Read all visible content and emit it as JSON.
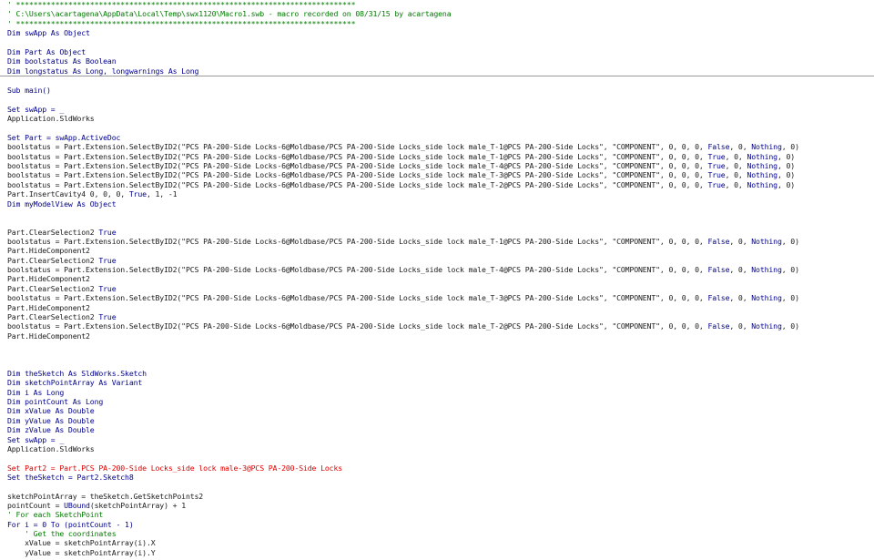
{
  "colors": {
    "background": "#ffffff",
    "keyword": "#00008b",
    "comment": "#007a00",
    "text": "#1a1a1a",
    "error": "#dd0000",
    "divider": "#9a9a9a"
  },
  "lines": [
    [
      {
        "t": "' ******************************************************************************",
        "c": "cm"
      }
    ],
    [
      {
        "t": "' C:\\Users\\acartagena\\AppData\\Local\\Temp\\swx1120\\Macro1.swb - macro recorded on 08/31/15 by acartagena",
        "c": "cm"
      }
    ],
    [
      {
        "t": "' ******************************************************************************",
        "c": "cm"
      }
    ],
    [
      {
        "t": "Dim swApp As Object",
        "c": "kw"
      }
    ],
    [],
    [
      {
        "t": "Dim Part As Object",
        "c": "kw"
      }
    ],
    [
      {
        "t": "Dim boolstatus As Boolean",
        "c": "kw"
      }
    ],
    [
      {
        "t": "Dim longstatus As Long, longwarnings As Long",
        "c": "kw"
      }
    ],
    [],
    [
      {
        "t": "Sub main()",
        "c": "kw"
      }
    ],
    [],
    [
      {
        "t": "Set swApp = _",
        "c": "kw"
      }
    ],
    [
      {
        "t": "Application.SldWorks",
        "c": "txt"
      }
    ],
    [],
    [
      {
        "t": "Set Part = swApp.ActiveDoc",
        "c": "kw"
      }
    ],
    [
      {
        "t": "boolstatus = Part.Extension.SelectByID2(\"PCS PA-200-Side Locks-6@Moldbase/PCS PA-200-Side Locks_side lock male_T-1@PCS PA-200-Side Locks\", \"COMPONENT\", 0, 0, 0, ",
        "c": "txt"
      },
      {
        "t": "False",
        "c": "kw"
      },
      {
        "t": ", 0, ",
        "c": "txt"
      },
      {
        "t": "Nothing",
        "c": "kw"
      },
      {
        "t": ", 0)",
        "c": "txt"
      }
    ],
    [
      {
        "t": "boolstatus = Part.Extension.SelectByID2(\"PCS PA-200-Side Locks-6@Moldbase/PCS PA-200-Side Locks_side lock male_T-1@PCS PA-200-Side Locks\", \"COMPONENT\", 0, 0, 0, ",
        "c": "txt"
      },
      {
        "t": "True",
        "c": "kw"
      },
      {
        "t": ", 0, ",
        "c": "txt"
      },
      {
        "t": "Nothing",
        "c": "kw"
      },
      {
        "t": ", 0)",
        "c": "txt"
      }
    ],
    [
      {
        "t": "boolstatus = Part.Extension.SelectByID2(\"PCS PA-200-Side Locks-6@Moldbase/PCS PA-200-Side Locks_side lock male_T-4@PCS PA-200-Side Locks\", \"COMPONENT\", 0, 0, 0, ",
        "c": "txt"
      },
      {
        "t": "True",
        "c": "kw"
      },
      {
        "t": ", 0, ",
        "c": "txt"
      },
      {
        "t": "Nothing",
        "c": "kw"
      },
      {
        "t": ", 0)",
        "c": "txt"
      }
    ],
    [
      {
        "t": "boolstatus = Part.Extension.SelectByID2(\"PCS PA-200-Side Locks-6@Moldbase/PCS PA-200-Side Locks_side lock male_T-3@PCS PA-200-Side Locks\", \"COMPONENT\", 0, 0, 0, ",
        "c": "txt"
      },
      {
        "t": "True",
        "c": "kw"
      },
      {
        "t": ", 0, ",
        "c": "txt"
      },
      {
        "t": "Nothing",
        "c": "kw"
      },
      {
        "t": ", 0)",
        "c": "txt"
      }
    ],
    [
      {
        "t": "boolstatus = Part.Extension.SelectByID2(\"PCS PA-200-Side Locks-6@Moldbase/PCS PA-200-Side Locks_side lock male_T-2@PCS PA-200-Side Locks\", \"COMPONENT\", 0, 0, 0, ",
        "c": "txt"
      },
      {
        "t": "True",
        "c": "kw"
      },
      {
        "t": ", 0, ",
        "c": "txt"
      },
      {
        "t": "Nothing",
        "c": "kw"
      },
      {
        "t": ", 0)",
        "c": "txt"
      }
    ],
    [
      {
        "t": "Part.InsertCavity4 0, 0, 0, ",
        "c": "txt"
      },
      {
        "t": "True",
        "c": "kw"
      },
      {
        "t": ", 1, -1",
        "c": "txt"
      }
    ],
    [
      {
        "t": "Dim myModelView As Object",
        "c": "kw"
      }
    ],
    [],
    [],
    [
      {
        "t": "Part.ClearSelection2 ",
        "c": "txt"
      },
      {
        "t": "True",
        "c": "kw"
      }
    ],
    [
      {
        "t": "boolstatus = Part.Extension.SelectByID2(\"PCS PA-200-Side Locks-6@Moldbase/PCS PA-200-Side Locks_side lock male_T-1@PCS PA-200-Side Locks\", \"COMPONENT\", 0, 0, 0, ",
        "c": "txt"
      },
      {
        "t": "False",
        "c": "kw"
      },
      {
        "t": ", 0, ",
        "c": "txt"
      },
      {
        "t": "Nothing",
        "c": "kw"
      },
      {
        "t": ", 0)",
        "c": "txt"
      }
    ],
    [
      {
        "t": "Part.HideComponent2",
        "c": "txt"
      }
    ],
    [
      {
        "t": "Part.ClearSelection2 ",
        "c": "txt"
      },
      {
        "t": "True",
        "c": "kw"
      }
    ],
    [
      {
        "t": "boolstatus = Part.Extension.SelectByID2(\"PCS PA-200-Side Locks-6@Moldbase/PCS PA-200-Side Locks_side lock male_T-4@PCS PA-200-Side Locks\", \"COMPONENT\", 0, 0, 0, ",
        "c": "txt"
      },
      {
        "t": "False",
        "c": "kw"
      },
      {
        "t": ", 0, ",
        "c": "txt"
      },
      {
        "t": "Nothing",
        "c": "kw"
      },
      {
        "t": ", 0)",
        "c": "txt"
      }
    ],
    [
      {
        "t": "Part.HideComponent2",
        "c": "txt"
      }
    ],
    [
      {
        "t": "Part.ClearSelection2 ",
        "c": "txt"
      },
      {
        "t": "True",
        "c": "kw"
      }
    ],
    [
      {
        "t": "boolstatus = Part.Extension.SelectByID2(\"PCS PA-200-Side Locks-6@Moldbase/PCS PA-200-Side Locks_side lock male_T-3@PCS PA-200-Side Locks\", \"COMPONENT\", 0, 0, 0, ",
        "c": "txt"
      },
      {
        "t": "False",
        "c": "kw"
      },
      {
        "t": ", 0, ",
        "c": "txt"
      },
      {
        "t": "Nothing",
        "c": "kw"
      },
      {
        "t": ", 0)",
        "c": "txt"
      }
    ],
    [
      {
        "t": "Part.HideComponent2",
        "c": "txt"
      }
    ],
    [
      {
        "t": "Part.ClearSelection2 ",
        "c": "txt"
      },
      {
        "t": "True",
        "c": "kw"
      }
    ],
    [
      {
        "t": "boolstatus = Part.Extension.SelectByID2(\"PCS PA-200-Side Locks-6@Moldbase/PCS PA-200-Side Locks_side lock male_T-2@PCS PA-200-Side Locks\", \"COMPONENT\", 0, 0, 0, ",
        "c": "txt"
      },
      {
        "t": "False",
        "c": "kw"
      },
      {
        "t": ", 0, ",
        "c": "txt"
      },
      {
        "t": "Nothing",
        "c": "kw"
      },
      {
        "t": ", 0)",
        "c": "txt"
      }
    ],
    [
      {
        "t": "Part.HideComponent2",
        "c": "txt"
      }
    ],
    [],
    [],
    [],
    [
      {
        "t": "Dim theSketch As SldWorks.Sketch",
        "c": "kw"
      }
    ],
    [
      {
        "t": "Dim sketchPointArray As Variant",
        "c": "kw"
      }
    ],
    [
      {
        "t": "Dim i As Long",
        "c": "kw"
      }
    ],
    [
      {
        "t": "Dim pointCount As Long",
        "c": "kw"
      }
    ],
    [
      {
        "t": "Dim xValue As Double",
        "c": "kw"
      }
    ],
    [
      {
        "t": "Dim yValue As Double",
        "c": "kw"
      }
    ],
    [
      {
        "t": "Dim zValue As Double",
        "c": "kw"
      }
    ],
    [
      {
        "t": "Set swApp = _",
        "c": "kw"
      }
    ],
    [
      {
        "t": "Application.SldWorks",
        "c": "txt"
      }
    ],
    [],
    [
      {
        "t": "Set Part2 = Part.PCS PA-200-Side Locks_side lock male-3@PCS PA-200-Side Locks",
        "c": "err"
      }
    ],
    [
      {
        "t": "Set theSketch = Part2.Sketch8",
        "c": "kw"
      }
    ],
    [],
    [
      {
        "t": "sketchPointArray = theSketch.GetSketchPoints2",
        "c": "txt"
      }
    ],
    [
      {
        "t": "pointCount = ",
        "c": "txt"
      },
      {
        "t": "UBound",
        "c": "kw"
      },
      {
        "t": "(sketchPointArray) + 1",
        "c": "txt"
      }
    ],
    [
      {
        "t": "' For each SketchPoint",
        "c": "cm"
      }
    ],
    [
      {
        "t": "For i = 0 To (pointCount - 1)",
        "c": "kw"
      }
    ],
    [
      {
        "t": "    ",
        "c": "ind"
      },
      {
        "t": "' Get the coordinates",
        "c": "cm"
      }
    ],
    [
      {
        "t": "    xValue = sketchPointArray(i).X",
        "c": "txt"
      }
    ],
    [
      {
        "t": "    yValue = sketchPointArray(i).Y",
        "c": "txt"
      }
    ]
  ],
  "dividers_after": [
    7
  ]
}
